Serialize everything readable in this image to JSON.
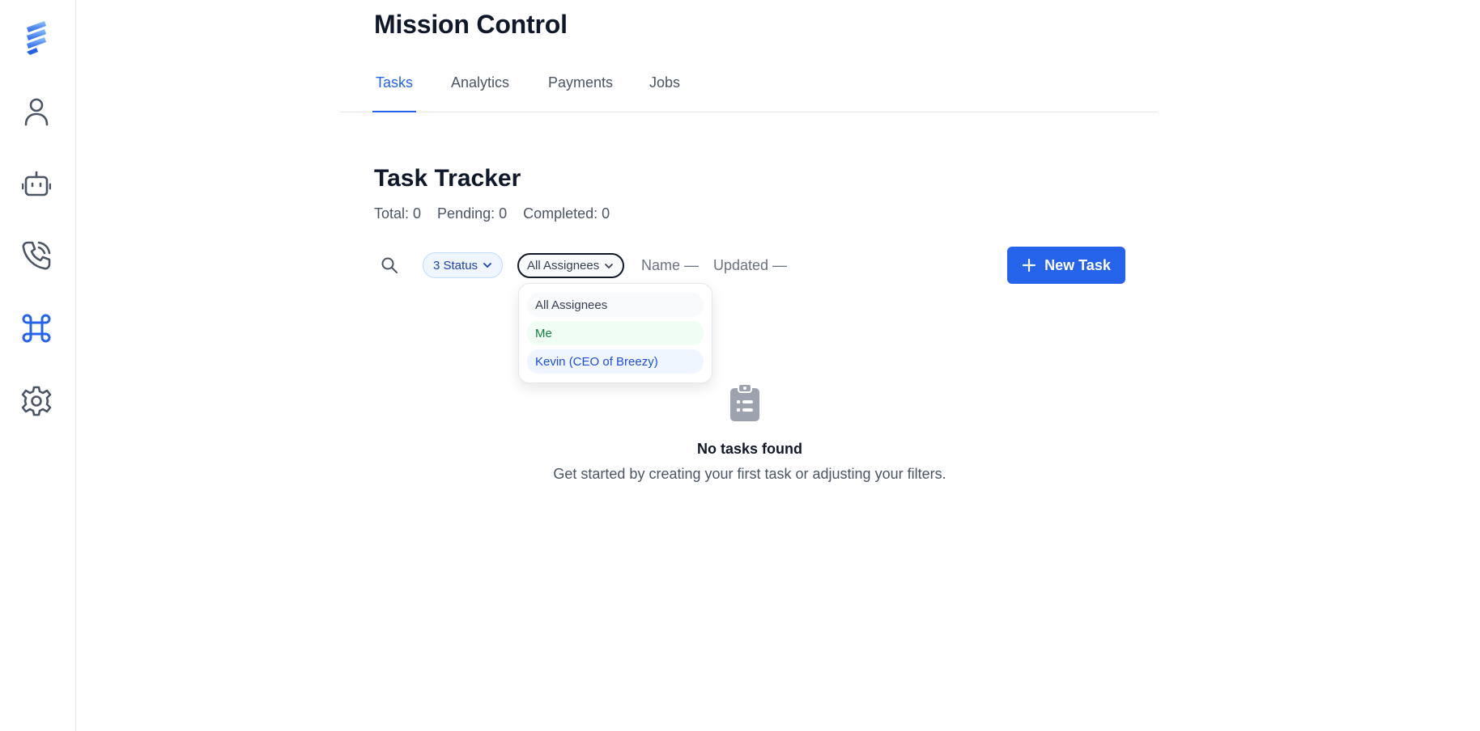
{
  "app": {
    "title": "Mission Control"
  },
  "sidebar": {
    "items": [
      {
        "icon": "logo-icon"
      },
      {
        "icon": "user-icon"
      },
      {
        "icon": "bot-icon"
      },
      {
        "icon": "phone-icon"
      },
      {
        "icon": "command-icon",
        "active": true
      },
      {
        "icon": "gear-icon"
      }
    ],
    "active_color": "#2563eb"
  },
  "tabs": [
    {
      "label": "Tasks",
      "active": true
    },
    {
      "label": "Analytics"
    },
    {
      "label": "Payments"
    },
    {
      "label": "Jobs"
    }
  ],
  "tracker": {
    "title": "Task Tracker",
    "stats": {
      "total": "Total: 0",
      "pending": "Pending: 0",
      "completed": "Completed: 0"
    }
  },
  "toolbar": {
    "search_icon": "search-icon",
    "status_filter": "3 Status",
    "assignee_filter": "All Assignees",
    "sort_name": "Name —",
    "sort_updated": "Updated —",
    "new_task": "New Task"
  },
  "assignee_dropdown": {
    "options": [
      {
        "label": "All Assignees"
      },
      {
        "label": "Me"
      },
      {
        "label": "Kevin (CEO of Breezy)"
      }
    ]
  },
  "empty_state": {
    "icon": "clipboard-icon",
    "title": "No tasks found",
    "subtitle": "Get started by creating your first task or adjusting your filters."
  },
  "colors": {
    "accent": "#2563eb",
    "text": "#0f172a",
    "muted": "#4b5563"
  }
}
